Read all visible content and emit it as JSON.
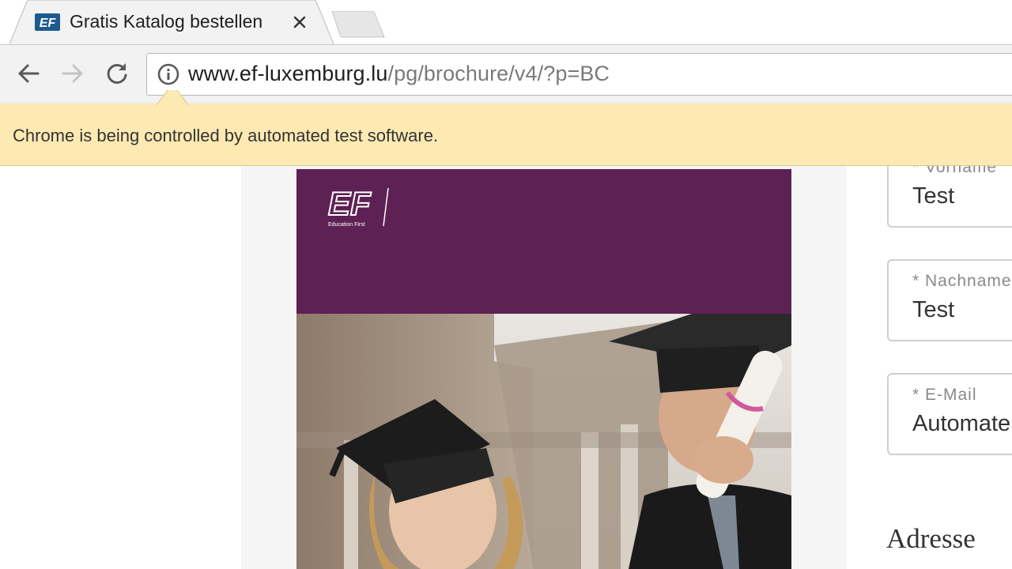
{
  "browser": {
    "tab": {
      "favicon": "ef-favicon-icon",
      "title": "Gratis Katalog bestellen",
      "close_icon": "close-icon"
    },
    "toolbar": {
      "back_icon": "back-arrow-icon",
      "forward_icon": "forward-arrow-icon",
      "reload_icon": "reload-icon",
      "site_info_icon": "info-icon"
    },
    "address_bar": {
      "domain": "www.ef-luxemburg.lu",
      "path": "/pg/brochure/v4/?p=BC"
    },
    "infobar": {
      "message": "Chrome is being controlled by automated test software."
    }
  },
  "page": {
    "brochure": {
      "brand_color": "#5e2153",
      "logo_text": "EF Education First"
    },
    "form": {
      "fields": [
        {
          "label": "* Vorname",
          "value": "Test"
        },
        {
          "label": "* Nachname",
          "value": "Test"
        },
        {
          "label": "* E-Mail",
          "value": "Automate"
        }
      ],
      "section_heading": "Adresse"
    }
  }
}
